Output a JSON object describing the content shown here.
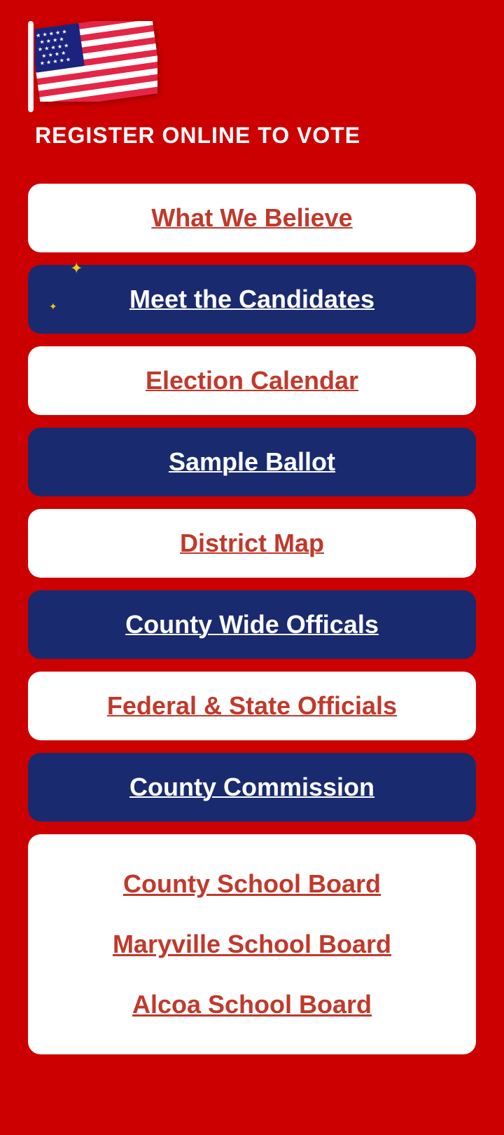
{
  "header": {
    "title": "REGISTER ONLINE TO VOTE",
    "background_color": "#cc0000",
    "text_color": "#ffffff"
  },
  "menu": {
    "items": [
      {
        "id": "what-we-believe",
        "label": "What We Believe",
        "style": "white",
        "has_sparkle": false
      },
      {
        "id": "meet-the-candidates",
        "label": "Meet the Candidates",
        "style": "dark",
        "has_sparkle": true
      },
      {
        "id": "election-calendar",
        "label": "Election Calendar",
        "style": "white",
        "has_sparkle": false
      },
      {
        "id": "sample-ballot",
        "label": "Sample Ballot",
        "style": "dark",
        "has_sparkle": false
      },
      {
        "id": "district-map",
        "label": "District Map",
        "style": "white",
        "has_sparkle": false
      },
      {
        "id": "county-wide-officials",
        "label": "County Wide Officals",
        "style": "dark",
        "has_sparkle": false
      },
      {
        "id": "federal-state-officials",
        "label": "Federal & State Officials",
        "style": "white",
        "has_sparkle": false
      },
      {
        "id": "county-commission",
        "label": "County Commission",
        "style": "dark",
        "has_sparkle": false
      }
    ],
    "last_card": {
      "style": "white",
      "sub_items": [
        {
          "id": "county-school-board",
          "label": "County School Board"
        },
        {
          "id": "maryville-school-board",
          "label": "Maryville School Board"
        },
        {
          "id": "alcoa-school-board",
          "label": "Alcoa School Board"
        }
      ]
    }
  },
  "sparkle": {
    "symbol": "✦",
    "small_symbol": "✦",
    "color": "#f5c518"
  }
}
